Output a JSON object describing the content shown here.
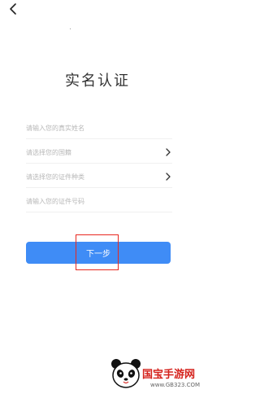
{
  "header": {
    "back_icon": "chevron-left-icon"
  },
  "page": {
    "title": "实名认证"
  },
  "form": {
    "name_placeholder": "请输入您的真实姓名",
    "country_placeholder": "请选择您的国籍",
    "id_type_placeholder": "请选择您的证件种类",
    "id_number_placeholder": "请输入您的证件号码",
    "chevron_icon": "chevron-right-icon"
  },
  "actions": {
    "next_label": "下一步"
  },
  "colors": {
    "accent": "#3f8cf6",
    "highlight": "#e8281f",
    "watermark": "#d5221c"
  },
  "watermark": {
    "logo": "panda-logo",
    "brand": "国宝手游网",
    "url": "www.GB323.COM"
  }
}
